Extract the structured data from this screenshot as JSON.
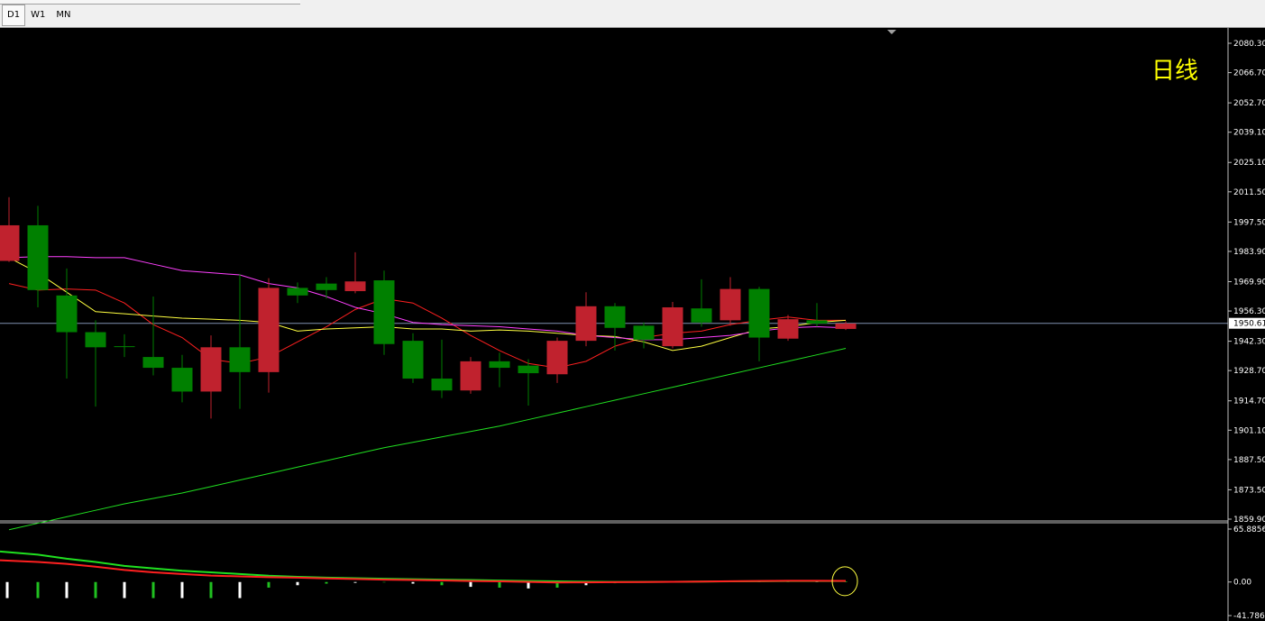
{
  "timeframe_tabs": [
    {
      "label": "D1",
      "active": true
    },
    {
      "label": "W1",
      "active": false
    },
    {
      "label": "MN",
      "active": false
    }
  ],
  "chart_label": "日线",
  "colors": {
    "background": "#000000",
    "bull_candle": "#008000",
    "bear_candle": "#c0222e",
    "ma_red": "#ff2020",
    "ma_yellow": "#ffff40",
    "ma_magenta": "#ff40ff",
    "ma_green": "#20e020",
    "price_line": "#8090b0",
    "label_yellow": "#ffff00"
  },
  "chart_data": {
    "type": "candlestick",
    "price_axis": {
      "ticks": [
        "2080.30",
        "2066.70",
        "2052.70",
        "2039.10",
        "2025.10",
        "2011.50",
        "1997.50",
        "1983.90",
        "1969.90",
        "1956.30",
        "1942.30",
        "1928.70",
        "1914.70",
        "1901.10",
        "1887.50",
        "1873.50",
        "1859.90"
      ],
      "range": [
        1859.9,
        2086.0
      ]
    },
    "current_price": "1950.61",
    "candles": [
      {
        "o": 1996.0,
        "h": 2009.0,
        "l": 1979.0,
        "c": 1979.5
      },
      {
        "o": 1966.0,
        "h": 2005.0,
        "l": 1958.0,
        "c": 1996.0
      },
      {
        "o": 1946.5,
        "h": 1976.0,
        "l": 1925.0,
        "c": 1963.5
      },
      {
        "o": 1939.5,
        "h": 1952.0,
        "l": 1912.0,
        "c": 1946.5
      },
      {
        "o": 1940.0,
        "h": 1945.5,
        "l": 1935.0,
        "c": 1940.0
      },
      {
        "o": 1930.0,
        "h": 1963.0,
        "l": 1926.5,
        "c": 1935.0
      },
      {
        "o": 1919.0,
        "h": 1936.0,
        "l": 1914.0,
        "c": 1930.0
      },
      {
        "o": 1939.5,
        "h": 1945.0,
        "l": 1906.5,
        "c": 1919.0
      },
      {
        "o": 1928.0,
        "h": 1973.5,
        "l": 1911.0,
        "c": 1939.5
      },
      {
        "o": 1967.0,
        "h": 1971.5,
        "l": 1918.5,
        "c": 1928.0
      },
      {
        "o": 1963.5,
        "h": 1969.5,
        "l": 1960.0,
        "c": 1967.0
      },
      {
        "o": 1966.0,
        "h": 1972.0,
        "l": 1962.0,
        "c": 1969.0
      },
      {
        "o": 1970.0,
        "h": 1983.5,
        "l": 1964.5,
        "c": 1965.5
      },
      {
        "o": 1941.0,
        "h": 1975.0,
        "l": 1936.0,
        "c": 1970.5
      },
      {
        "o": 1925.0,
        "h": 1946.0,
        "l": 1923.0,
        "c": 1942.5
      },
      {
        "o": 1919.5,
        "h": 1943.0,
        "l": 1916.0,
        "c": 1925.0
      },
      {
        "o": 1933.0,
        "h": 1935.0,
        "l": 1918.0,
        "c": 1919.5
      },
      {
        "o": 1930.0,
        "h": 1937.0,
        "l": 1921.0,
        "c": 1933.0
      },
      {
        "o": 1927.5,
        "h": 1934.0,
        "l": 1912.5,
        "c": 1931.0
      },
      {
        "o": 1942.5,
        "h": 1944.0,
        "l": 1923.0,
        "c": 1927.0
      },
      {
        "o": 1958.5,
        "h": 1965.0,
        "l": 1940.0,
        "c": 1942.5
      },
      {
        "o": 1948.5,
        "h": 1960.0,
        "l": 1938.0,
        "c": 1958.5
      },
      {
        "o": 1943.0,
        "h": 1951.0,
        "l": 1939.0,
        "c": 1949.5
      },
      {
        "o": 1958.0,
        "h": 1960.5,
        "l": 1939.0,
        "c": 1940.0
      },
      {
        "o": 1951.0,
        "h": 1971.0,
        "l": 1949.0,
        "c": 1957.5
      },
      {
        "o": 1966.5,
        "h": 1972.0,
        "l": 1949.5,
        "c": 1952.0
      },
      {
        "o": 1944.0,
        "h": 1967.5,
        "l": 1933.0,
        "c": 1966.5
      },
      {
        "o": 1952.5,
        "h": 1954.5,
        "l": 1942.5,
        "c": 1943.5
      },
      {
        "o": 1950.5,
        "h": 1960.0,
        "l": 1949.0,
        "c": 1952.0
      },
      {
        "o": 1950.5,
        "h": 1951.5,
        "l": 1947.5,
        "c": 1948.0
      }
    ],
    "moving_averages": [
      {
        "color": "#ff2020",
        "values": [
          1969,
          1966,
          1966.5,
          1966,
          1960,
          1950,
          1944,
          1934,
          1932,
          1935,
          1942,
          1949,
          1957,
          1962,
          1960,
          1953,
          1945,
          1938,
          1932,
          1930,
          1933,
          1940,
          1944,
          1946,
          1947,
          1950,
          1952,
          1953.5,
          1952,
          1952
        ]
      },
      {
        "color": "#ffff40",
        "values": [
          1981,
          1974,
          1965,
          1956,
          1955,
          1954,
          1953,
          1952.5,
          1952,
          1951,
          1947,
          1948,
          1948.5,
          1949,
          1948,
          1948,
          1947,
          1947.5,
          1947,
          1946,
          1945,
          1944.5,
          1942,
          1938,
          1940,
          1944,
          1948,
          1949,
          1951,
          1952
        ]
      },
      {
        "color": "#ff40ff",
        "values": [
          1981,
          1981.5,
          1981.5,
          1981,
          1981,
          1978,
          1975,
          1974,
          1973,
          1969,
          1967,
          1963,
          1958,
          1955,
          1951,
          1950,
          1949.5,
          1949,
          1948,
          1947,
          1945,
          1944,
          1943,
          1943,
          1944,
          1945,
          1947,
          1948.5,
          1949,
          1948.5
        ]
      },
      {
        "color": "#20e020",
        "values": [
          1855,
          1858,
          1861,
          1864,
          1867,
          1869.5,
          1872,
          1875,
          1878,
          1881,
          1884,
          1887,
          1890,
          1893,
          1895.5,
          1898,
          1900.5,
          1903,
          1906,
          1909,
          1912,
          1915,
          1918,
          1921,
          1924,
          1927,
          1930,
          1933,
          1936,
          1939
        ]
      }
    ],
    "oscillator": {
      "axis_ticks": [
        "65.8856",
        "0.00",
        "-41.7864"
      ],
      "range": [
        -41.7864,
        65.8856
      ],
      "histogram": [
        -20,
        -20,
        -20,
        -20,
        -20,
        -20,
        -20,
        -20,
        -20,
        -7,
        -4,
        -2,
        -1,
        -0.5,
        -2,
        -4,
        -6,
        -7,
        -8,
        -7,
        -4,
        -1.5,
        0,
        0,
        0,
        1.5,
        1.5,
        1,
        1,
        0.8
      ],
      "green_line": [
        38,
        34,
        29,
        25,
        20,
        17,
        14,
        12,
        10,
        7.8,
        6.5,
        5.5,
        4.8,
        4,
        3.5,
        3,
        2.5,
        1.8,
        1.2,
        0.8,
        0.4,
        0.2,
        0.1,
        0.3,
        0.6,
        0.8,
        1,
        1.2,
        1.3,
        1.2
      ],
      "red_line": [
        27,
        25,
        22.5,
        19,
        15,
        12,
        10,
        8,
        7,
        6,
        5.5,
        4.5,
        3.8,
        3,
        2.5,
        2,
        1.2,
        0.8,
        0.2,
        -0.5,
        -0.4,
        -0.2,
        0,
        0.3,
        0.6,
        1,
        1.3,
        1.5,
        1.5,
        1.4
      ]
    }
  }
}
